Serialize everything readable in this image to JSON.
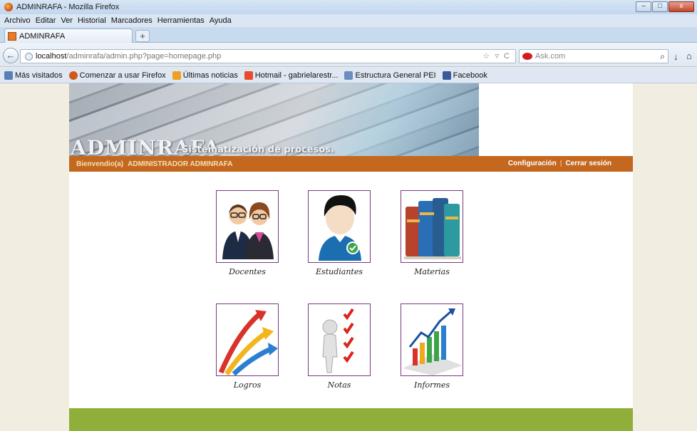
{
  "window": {
    "title": "ADMINRAFA - Mozilla Firefox",
    "buttons": [
      "–",
      "□",
      "x"
    ]
  },
  "menu": [
    "Archivo",
    "Editar",
    "Ver",
    "Historial",
    "Marcadores",
    "Herramientas",
    "Ayuda"
  ],
  "tab": {
    "label": "ADMINRAFA",
    "new_tab": "+"
  },
  "nav": {
    "back": "←",
    "url_host": "localhost",
    "url_rest": "/adminrafa/admin.php?page=homepage.php",
    "url_tools": "☆ ▿ C",
    "search_placeholder": "Ask.com",
    "search_glyph": "⌕",
    "download_glyph": "↓",
    "home_glyph": "⌂"
  },
  "bookmarks": [
    {
      "label": "Más visitados",
      "icon": "most-visited-icon",
      "color": "#5a7fb5"
    },
    {
      "label": "Comenzar a usar Firefox",
      "icon": "firefox-icon",
      "color": "#d2571b"
    },
    {
      "label": "Últimas noticias",
      "icon": "rss-icon",
      "color": "#f0a020"
    },
    {
      "label": "Hotmail - gabrielarestr...",
      "icon": "hotmail-icon",
      "color": "#e84a2a"
    },
    {
      "label": "Estructura General PEI",
      "icon": "image-icon",
      "color": "#6a8fbf"
    },
    {
      "label": "Facebook",
      "icon": "facebook-icon",
      "color": "#3b5998"
    }
  ],
  "site": {
    "logo": "ADMINRAFA",
    "subtitle": "Sistematización de procesos.",
    "welcome": "Bienvendio(a)",
    "username": "ADMINISTRADOR ADMINRAFA",
    "config_link": "Configuración",
    "separator": "|",
    "logout_link": "Cerrar sesión"
  },
  "modules": [
    {
      "label": "Docentes",
      "icon": "teachers-icon"
    },
    {
      "label": "Estudiantes",
      "icon": "student-icon"
    },
    {
      "label": "Materias",
      "icon": "books-icon"
    },
    {
      "label": "Logros",
      "icon": "growth-arrows-icon"
    },
    {
      "label": "Notas",
      "icon": "checklist-icon"
    },
    {
      "label": "Informes",
      "icon": "report-chart-icon"
    }
  ],
  "colors": {
    "userbar": "#c46820",
    "footer": "#8fae3a",
    "icon_border": "#7a3a82"
  }
}
